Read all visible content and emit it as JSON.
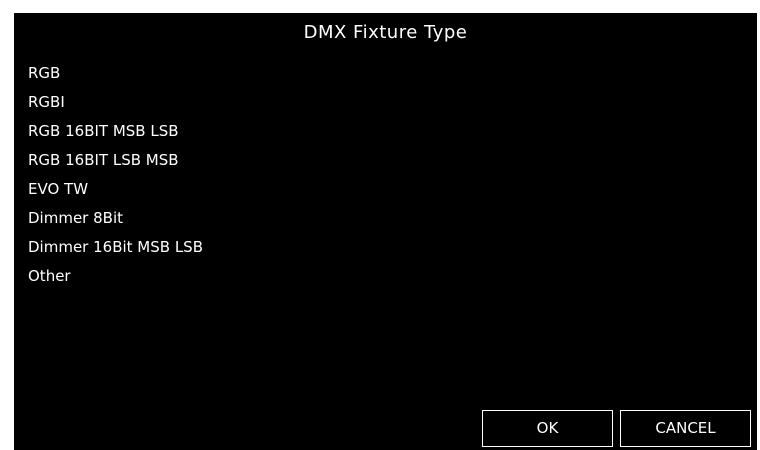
{
  "dialog": {
    "title": "DMX Fixture Type",
    "options": [
      "RGB",
      "RGBI",
      "RGB 16BIT MSB LSB",
      "RGB 16BIT LSB MSB",
      "EVO TW",
      "Dimmer 8Bit",
      "Dimmer 16Bit MSB LSB",
      "Other"
    ],
    "ok_label": "OK",
    "cancel_label": "CANCEL"
  },
  "colors": {
    "background": "#000000",
    "foreground": "#ffffff"
  }
}
